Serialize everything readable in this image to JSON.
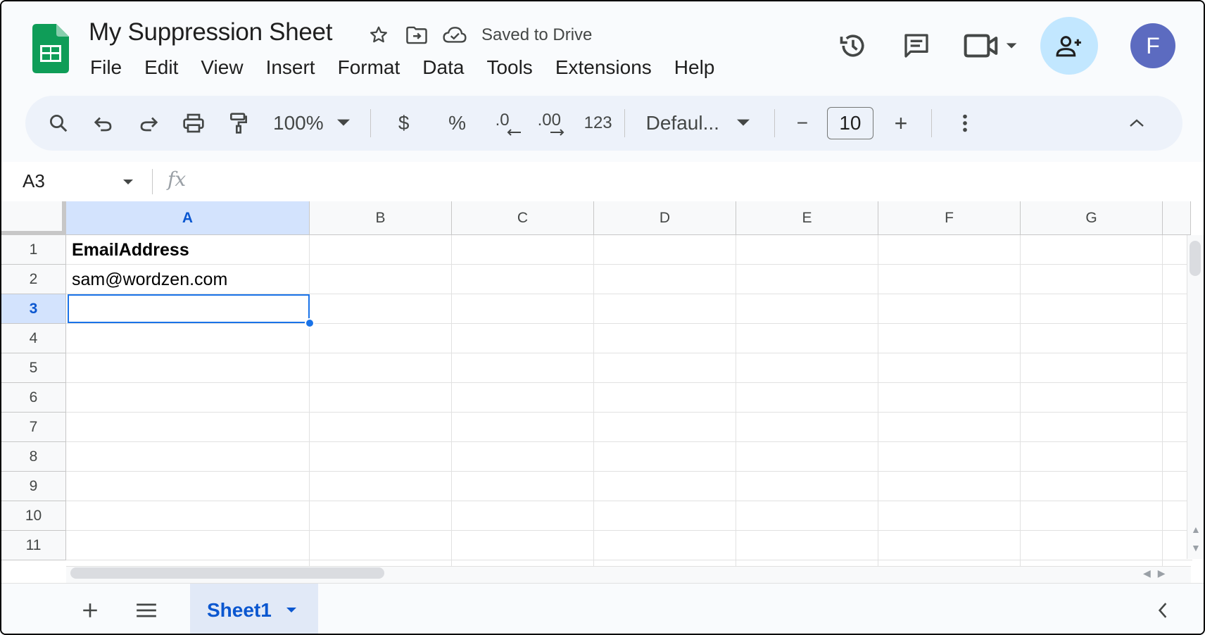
{
  "app": {
    "title": "My Suppression Sheet",
    "saved_status": "Saved to Drive",
    "avatar_letter": "F"
  },
  "menu": [
    "File",
    "Edit",
    "View",
    "Insert",
    "Format",
    "Data",
    "Tools",
    "Extensions",
    "Help"
  ],
  "toolbar": {
    "zoom": "100%",
    "currency": "$",
    "percent": "%",
    "decrease_decimal": ".0",
    "increase_decimal": ".00",
    "number_format": "123",
    "font": "Defaul...",
    "font_size": "10",
    "decrease_font": "−",
    "increase_font": "+"
  },
  "formula_bar": {
    "cell_ref": "A3",
    "fx_label": "fx",
    "value": ""
  },
  "grid": {
    "columns": [
      "A",
      "B",
      "C",
      "D",
      "E",
      "F",
      "G"
    ],
    "rows": [
      "1",
      "2",
      "3",
      "4",
      "5",
      "6",
      "7",
      "8",
      "9",
      "10",
      "11"
    ],
    "selected_column": "A",
    "selected_row": "3",
    "cells": {
      "A1": "EmailAddress",
      "A2": "sam@wordzen.com"
    }
  },
  "sheets": {
    "active": "Sheet1"
  },
  "colors": {
    "accent": "#0b57d0",
    "selection": "#1a73e8",
    "header_selected_bg": "#d3e3fd",
    "toolbar_bg": "#edf2fa",
    "share_bg": "#c2e7ff",
    "avatar_bg": "#5c6bc0",
    "sheets_green": "#0f9d58"
  }
}
